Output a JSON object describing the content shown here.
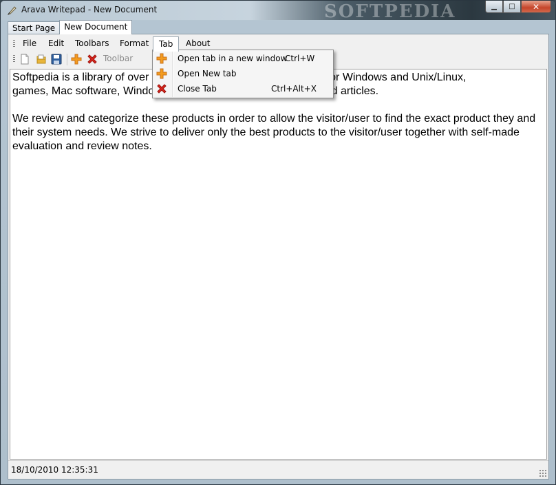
{
  "window": {
    "title": "Arava Writepad - New Document",
    "watermark": "SOFTPEDIA",
    "controls": {
      "minimize": "▁",
      "maximize": "□",
      "close": "✕"
    }
  },
  "tabs": [
    {
      "label": "Start Page",
      "active": false
    },
    {
      "label": "New Document",
      "active": true
    }
  ],
  "menu": {
    "items": [
      "File",
      "Edit",
      "Toolbars",
      "Format",
      "Tab",
      "About"
    ],
    "open_item": "Tab"
  },
  "toolbar": {
    "label": "Toolbar",
    "icons": [
      "new-document-icon",
      "open-folder-icon",
      "save-disk-icon",
      "add-tab-icon",
      "close-tab-icon"
    ]
  },
  "tab_menu": [
    {
      "label": "Open tab in a new window",
      "shortcut": "Ctrl+W",
      "icon": "plus-icon"
    },
    {
      "label": "Open New tab",
      "shortcut": "",
      "icon": "plus-icon"
    },
    {
      "label": "Close Tab",
      "shortcut": "Ctrl+Alt+X",
      "icon": "x-icon"
    }
  ],
  "editor": {
    "line1_a": "Softpedia is a library of over 4",
    "line1_b": "programs for Windows and Unix/Linux,",
    "line2_a": "games, Mac software, Windo",
    "line2_b": "ted articles.",
    "paragraph2": "We review and categorize these products in order to allow the visitor/user to find the exact product they and their system needs. We strive to deliver only the best products to the visitor/user together with self-made evaluation and review notes."
  },
  "status": {
    "datetime": "18/10/2010 12:35:31"
  },
  "colors": {
    "accent_plus": "#f39c1f",
    "accent_x": "#d9251c"
  }
}
